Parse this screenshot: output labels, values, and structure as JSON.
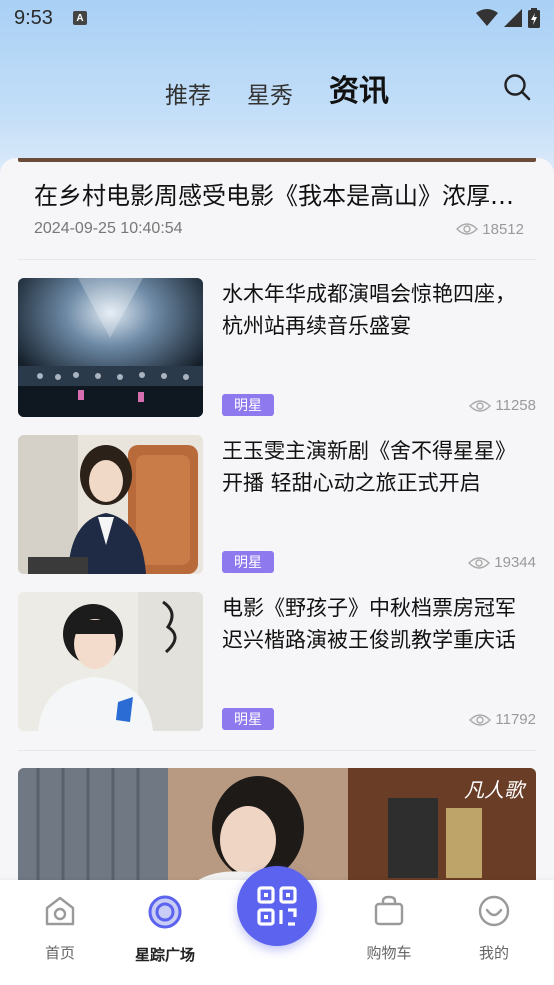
{
  "status_bar": {
    "time": "9:53",
    "notif_icon": "a-icon",
    "icons": [
      "wifi-icon",
      "signal-icon",
      "battery-icon"
    ]
  },
  "header": {
    "tabs": [
      {
        "label": "推荐"
      },
      {
        "label": "星秀"
      },
      {
        "label": "资讯",
        "active": true
      }
    ],
    "search_icon": "search-icon"
  },
  "featured": {
    "title": "在乡村电影周感受电影《我本是高山》浓厚…",
    "datetime": "2024-09-25 10:40:54",
    "views": "18512"
  },
  "news": [
    {
      "title": "水木年华成都演唱会惊艳四座，杭州站再续音乐盛宴",
      "tag": "明星",
      "views": "11258",
      "image": "concert-stage"
    },
    {
      "title": "王玉雯主演新剧《舍不得星星》开播 轻甜心动之旅正式开启",
      "tag": "明星",
      "views": "19344",
      "image": "actress-office"
    },
    {
      "title": "电影《野孩子》中秋档票房冠军 迟兴楷路演被王俊凯教学重庆话",
      "tag": "明星",
      "views": "11792",
      "image": "young-actor"
    }
  ],
  "bottom_card": {
    "logo_text": "凡人歌"
  },
  "bottom_nav": {
    "items": [
      {
        "label": "首页",
        "icon": "home-icon"
      },
      {
        "label": "星踪广场",
        "icon": "target-icon",
        "active": true
      },
      {
        "label": "",
        "icon": "qr-scan-icon"
      },
      {
        "label": "购物车",
        "icon": "shopping-bag-icon"
      },
      {
        "label": "我的",
        "icon": "smile-icon"
      }
    ]
  },
  "colors": {
    "accent": "#5b63ef",
    "tag": "#8f79ee",
    "nav_icon": "#9a9a9a"
  }
}
